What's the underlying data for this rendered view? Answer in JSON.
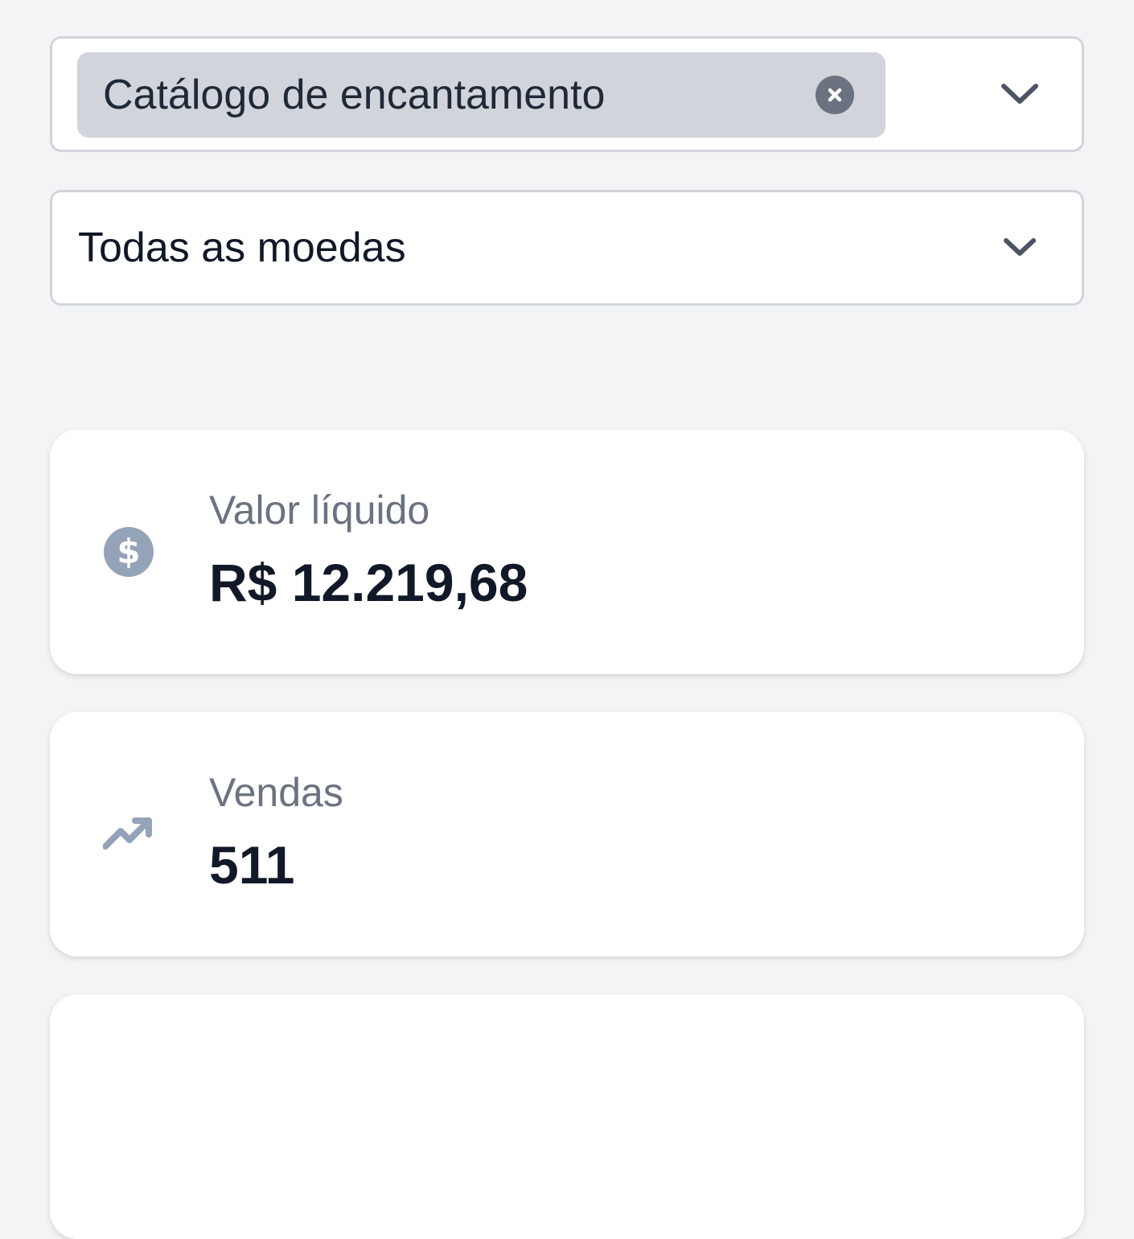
{
  "filters": {
    "product": {
      "selected_chip": "Catálogo de encantamento"
    },
    "currency": {
      "selected_value": "Todas as moedas"
    }
  },
  "stats": {
    "net_value": {
      "label": "Valor líquido",
      "value": "R$ 12.219,68",
      "icon": "dollar-circle-icon"
    },
    "sales": {
      "label": "Vendas",
      "value": "511",
      "icon": "trending-up-icon"
    }
  },
  "colors": {
    "background": "#f3f4f6",
    "card": "#ffffff",
    "chip": "#d1d5db",
    "muted_text": "#6b7280",
    "primary_text": "#111827",
    "icon": "#94a3b8"
  }
}
